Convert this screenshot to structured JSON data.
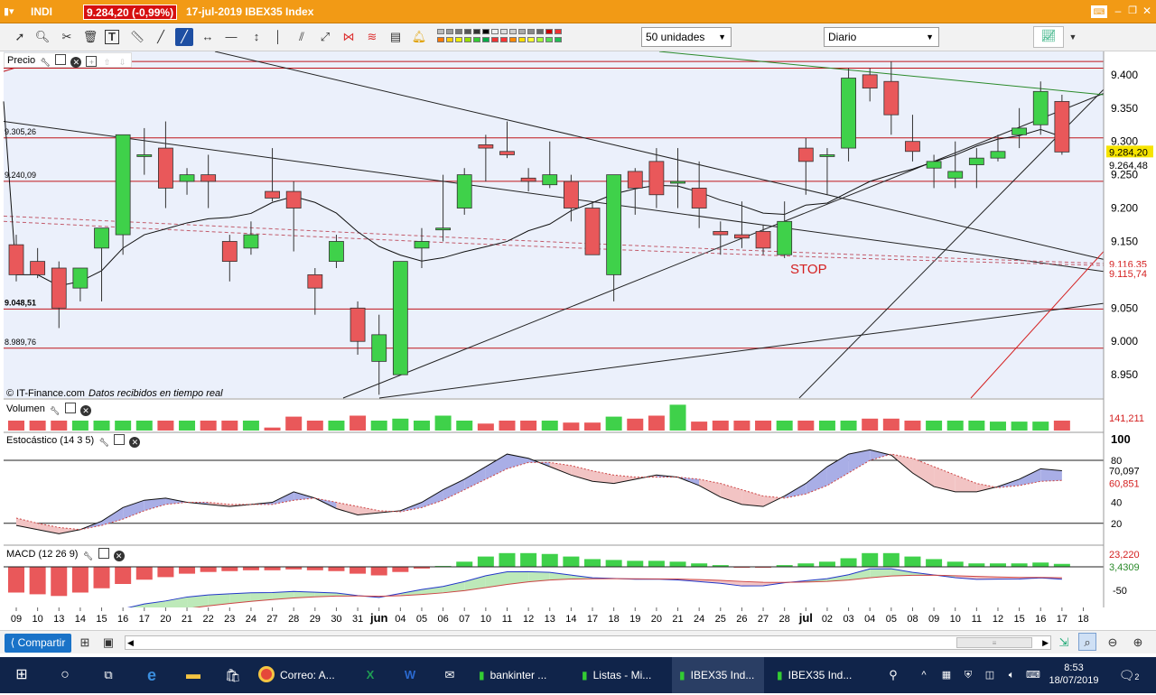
{
  "title_bar": {
    "app_name": "INDI",
    "price": "9.284,20 (-0,99%)",
    "info": "17-jul-2019  IBEX35 Index"
  },
  "toolbar": {
    "units_value": "50 unidades",
    "period_value": "Diario"
  },
  "price_panel": {
    "header": "Precio",
    "copyright": "© IT-Finance.com",
    "realtime_note": "Datos recibidos en tiempo real",
    "stop_label": "STOP",
    "left_levels": [
      "9.305,26",
      "9.240,09",
      "9.048,51",
      "8.989,76"
    ],
    "y_ticks": [
      "9.400",
      "9.350",
      "9.300",
      "9.250",
      "9.200",
      "9.150",
      "9.100",
      "9.050",
      "9.000",
      "8.950"
    ],
    "tag_last": "9.284,20",
    "tag_ma": "9.264,48",
    "tag_a": "9.116,35",
    "tag_b": "9.115,74"
  },
  "volume_panel": {
    "header": "Volumen",
    "tag": "141,211"
  },
  "stoch_panel": {
    "header": "Estocástico (14 3 5)",
    "ticks": [
      "100",
      "80",
      "40",
      "20"
    ],
    "tag_k": "70,097",
    "tag_d": "60,851"
  },
  "macd_panel": {
    "header": "MACD (12 26 9)",
    "tag_a": "23,220",
    "tag_b": "3,4309",
    "tick": "-50"
  },
  "x_labels": [
    "09",
    "10",
    "13",
    "14",
    "15",
    "16",
    "17",
    "20",
    "21",
    "22",
    "23",
    "24",
    "27",
    "28",
    "29",
    "30",
    "31",
    "jun",
    "04",
    "05",
    "06",
    "07",
    "10",
    "11",
    "12",
    "13",
    "14",
    "17",
    "18",
    "19",
    "20",
    "21",
    "24",
    "25",
    "26",
    "27",
    "28",
    "jul",
    "02",
    "03",
    "04",
    "05",
    "08",
    "09",
    "10",
    "11",
    "12",
    "15",
    "16",
    "17",
    "18"
  ],
  "bottom_bar": {
    "share_label": "Compartir"
  },
  "taskbar": {
    "items": [
      "Correo: A...",
      "bankinter ...",
      "Listas - Mi...",
      "IBEX35 Ind...",
      "IBEX35 Ind..."
    ],
    "time": "8:53",
    "date": "18/07/2019",
    "notif_count": "2"
  },
  "chart_data": {
    "type": "candlestick",
    "categories": [
      "09",
      "10",
      "13",
      "14",
      "15",
      "16",
      "17",
      "20",
      "21",
      "22",
      "23",
      "24",
      "27",
      "28",
      "29",
      "30",
      "31",
      "jun",
      "04",
      "05",
      "06",
      "07",
      "10",
      "11",
      "12",
      "13",
      "14",
      "17",
      "18",
      "19",
      "20",
      "21",
      "24",
      "25",
      "26",
      "27",
      "28",
      "jul",
      "02",
      "03",
      "04",
      "05",
      "08",
      "09",
      "10",
      "11",
      "12",
      "15",
      "16",
      "17"
    ],
    "ohlc": [
      [
        9145,
        9160,
        9090,
        9100
      ],
      [
        9120,
        9140,
        9095,
        9100
      ],
      [
        9110,
        9120,
        9020,
        9050
      ],
      [
        9080,
        9110,
        9060,
        9110
      ],
      [
        9140,
        9150,
        9060,
        9170
      ],
      [
        9160,
        9310,
        9130,
        9310
      ],
      [
        9280,
        9320,
        9250,
        9280
      ],
      [
        9290,
        9330,
        9200,
        9230
      ],
      [
        9240,
        9260,
        9220,
        9250
      ],
      [
        9250,
        9280,
        9200,
        9240
      ],
      [
        9150,
        9160,
        9090,
        9120
      ],
      [
        9140,
        9180,
        9130,
        9160
      ],
      [
        9225,
        9290,
        9210,
        9215
      ],
      [
        9225,
        9240,
        9135,
        9200
      ],
      [
        9100,
        9110,
        9040,
        9080
      ],
      [
        9120,
        9160,
        9110,
        9150
      ],
      [
        9050,
        9060,
        8980,
        9000
      ],
      [
        8970,
        9040,
        8920,
        9010
      ],
      [
        8950,
        9080,
        8950,
        9120
      ],
      [
        9140,
        9170,
        9110,
        9150
      ],
      [
        9170,
        9250,
        9150,
        9170
      ],
      [
        9200,
        9260,
        9190,
        9250
      ],
      [
        9295,
        9310,
        9240,
        9290
      ],
      [
        9285,
        9330,
        9275,
        9280
      ],
      [
        9245,
        9260,
        9225,
        9240
      ],
      [
        9235,
        9300,
        9230,
        9250
      ],
      [
        9240,
        9250,
        9180,
        9200
      ],
      [
        9200,
        9210,
        9130,
        9130
      ],
      [
        9100,
        9250,
        9060,
        9250
      ],
      [
        9255,
        9260,
        9190,
        9230
      ],
      [
        9270,
        9290,
        9200,
        9220
      ],
      [
        9240,
        9290,
        9200,
        9240
      ],
      [
        9230,
        9270,
        9170,
        9200
      ],
      [
        9165,
        9180,
        9130,
        9160
      ],
      [
        9160,
        9210,
        9140,
        9155
      ],
      [
        9165,
        9175,
        9130,
        9140
      ],
      [
        9130,
        9210,
        9125,
        9180
      ],
      [
        9290,
        9305,
        9220,
        9270
      ],
      [
        9280,
        9290,
        9220,
        9280
      ],
      [
        9290,
        9410,
        9270,
        9395
      ],
      [
        9400,
        9410,
        9360,
        9380
      ],
      [
        9390,
        9420,
        9310,
        9340
      ],
      [
        9300,
        9340,
        9270,
        9285
      ],
      [
        9260,
        9280,
        9230,
        9270
      ],
      [
        9245,
        9300,
        9230,
        9255
      ],
      [
        9265,
        9290,
        9230,
        9275
      ],
      [
        9275,
        9310,
        9270,
        9285
      ],
      [
        9310,
        9350,
        9290,
        9320
      ],
      [
        9325,
        9390,
        9310,
        9375
      ],
      [
        9360,
        9370,
        9280,
        9284.2
      ]
    ],
    "ylim": [
      8915,
      9435
    ],
    "volume": [
      1,
      1,
      1,
      1,
      1,
      1,
      1,
      1,
      1,
      1,
      1,
      1,
      0.3,
      1.4,
      1,
      1,
      1.5,
      1,
      1.2,
      1,
      1.5,
      1,
      0.7,
      1,
      1,
      1,
      0.8,
      0.8,
      1.4,
      1.2,
      1.5,
      2.6,
      0.9,
      1,
      1,
      1,
      1,
      1,
      1,
      1,
      1.2,
      1.2,
      1,
      1,
      1,
      1,
      0.9,
      0.9,
      0.9,
      1
    ],
    "stochastic_k": [
      18,
      14,
      10,
      14,
      22,
      35,
      42,
      44,
      40,
      38,
      36,
      38,
      40,
      50,
      44,
      34,
      28,
      30,
      32,
      40,
      52,
      62,
      74,
      86,
      82,
      74,
      66,
      60,
      58,
      62,
      66,
      64,
      56,
      45,
      38,
      36,
      46,
      58,
      74,
      86,
      90,
      85,
      68,
      55,
      50,
      50,
      55,
      62,
      72,
      70.1
    ],
    "stochastic_d": [
      25,
      20,
      16,
      14,
      18,
      24,
      32,
      38,
      40,
      40,
      38,
      38,
      38,
      42,
      44,
      40,
      36,
      32,
      31,
      35,
      42,
      52,
      62,
      72,
      78,
      78,
      75,
      70,
      66,
      64,
      64,
      64,
      62,
      58,
      52,
      46,
      44,
      48,
      56,
      68,
      80,
      86,
      82,
      74,
      66,
      58,
      54,
      56,
      60,
      60.9
    ],
    "macd_bars": [
      -30,
      -32,
      -34,
      -30,
      -25,
      -20,
      -15,
      -12,
      -8,
      -6,
      -5,
      -4,
      -4,
      -3,
      -4,
      -5,
      -8,
      -10,
      -6,
      -2,
      1,
      6,
      12,
      16,
      16,
      15,
      12,
      9,
      8,
      7,
      7,
      6,
      4,
      2,
      -1,
      -1,
      2,
      4,
      6,
      10,
      16,
      16,
      12,
      9,
      6,
      4,
      4,
      4,
      5,
      3.43
    ],
    "legend": []
  }
}
